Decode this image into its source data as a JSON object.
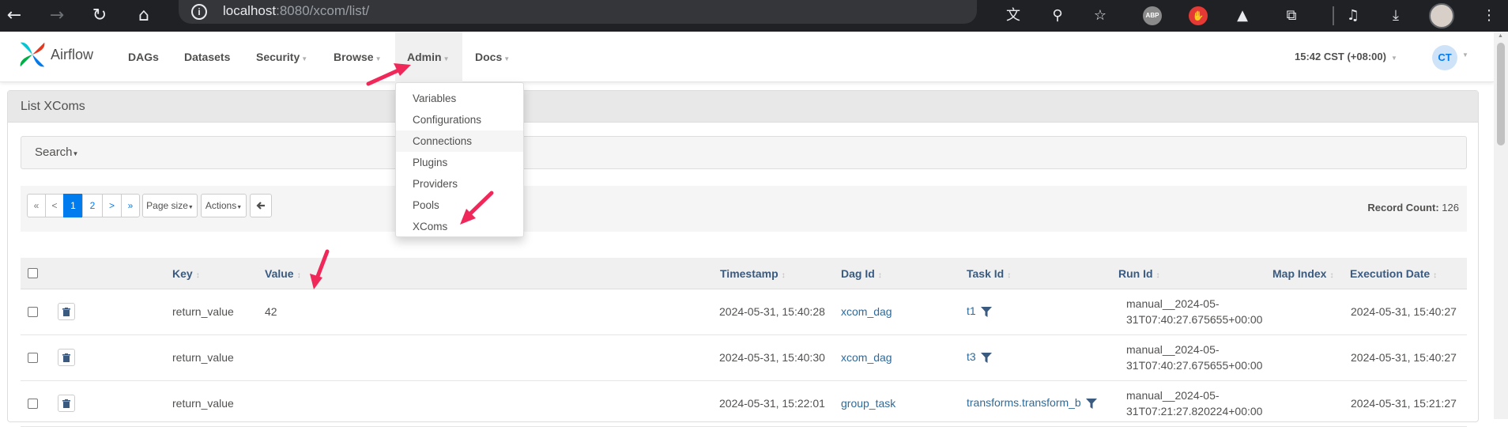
{
  "browser": {
    "url_host": "localhost",
    "url_rest": ":8080/xcom/list/",
    "abp_label": "ABP"
  },
  "navbar": {
    "brand": "Airflow",
    "items": [
      {
        "label": "DAGs",
        "has_caret": false
      },
      {
        "label": "Datasets",
        "has_caret": false
      },
      {
        "label": "Security",
        "has_caret": true
      },
      {
        "label": "Browse",
        "has_caret": true
      },
      {
        "label": "Admin",
        "has_caret": true,
        "active": true
      },
      {
        "label": "Docs",
        "has_caret": true
      }
    ],
    "clock": "15:42 CST (+08:00)",
    "user_initials": "CT"
  },
  "admin_menu": {
    "items": [
      "Variables",
      "Configurations",
      "Connections",
      "Plugins",
      "Providers",
      "Pools",
      "XComs"
    ],
    "hovered": "Connections"
  },
  "page": {
    "title": "List XComs",
    "search_label": "Search",
    "pagination": {
      "first": "«",
      "prev": "<",
      "pages": [
        "1",
        "2"
      ],
      "current": "1",
      "next": ">",
      "last": "»"
    },
    "page_size_label": "Page size",
    "actions_label": "Actions",
    "back_icon": "arrow-left-icon",
    "record_count_label": "Record Count:",
    "record_count": "126"
  },
  "table": {
    "columns": [
      "Key",
      "Value",
      "Timestamp",
      "Dag Id",
      "Task Id",
      "Run Id",
      "Map Index",
      "Execution Date"
    ],
    "rows": [
      {
        "key": "return_value",
        "value": "42",
        "timestamp": "2024-05-31, 15:40:28",
        "dag_id": "xcom_dag",
        "task_id": "t1",
        "run_id_1": "manual__2024-05-",
        "run_id_2": "31T07:40:27.675655+00:00",
        "map_index": "",
        "execution_date": "2024-05-31, 15:40:27"
      },
      {
        "key": "return_value",
        "value": "",
        "timestamp": "2024-05-31, 15:40:30",
        "dag_id": "xcom_dag",
        "task_id": "t3",
        "run_id_1": "manual__2024-05-",
        "run_id_2": "31T07:40:27.675655+00:00",
        "map_index": "",
        "execution_date": "2024-05-31, 15:40:27"
      },
      {
        "key": "return_value",
        "value": "",
        "timestamp": "2024-05-31, 15:22:01",
        "dag_id": "group_task",
        "task_id": "transforms.transform_b",
        "run_id_1": "manual__2024-05-",
        "run_id_2": "31T07:21:27.820224+00:00",
        "map_index": "",
        "execution_date": "2024-05-31, 15:21:27"
      }
    ]
  },
  "colors": {
    "accent": "#017cee",
    "annotation_arrow": "#f0285a",
    "header_text": "#3a5a80"
  }
}
